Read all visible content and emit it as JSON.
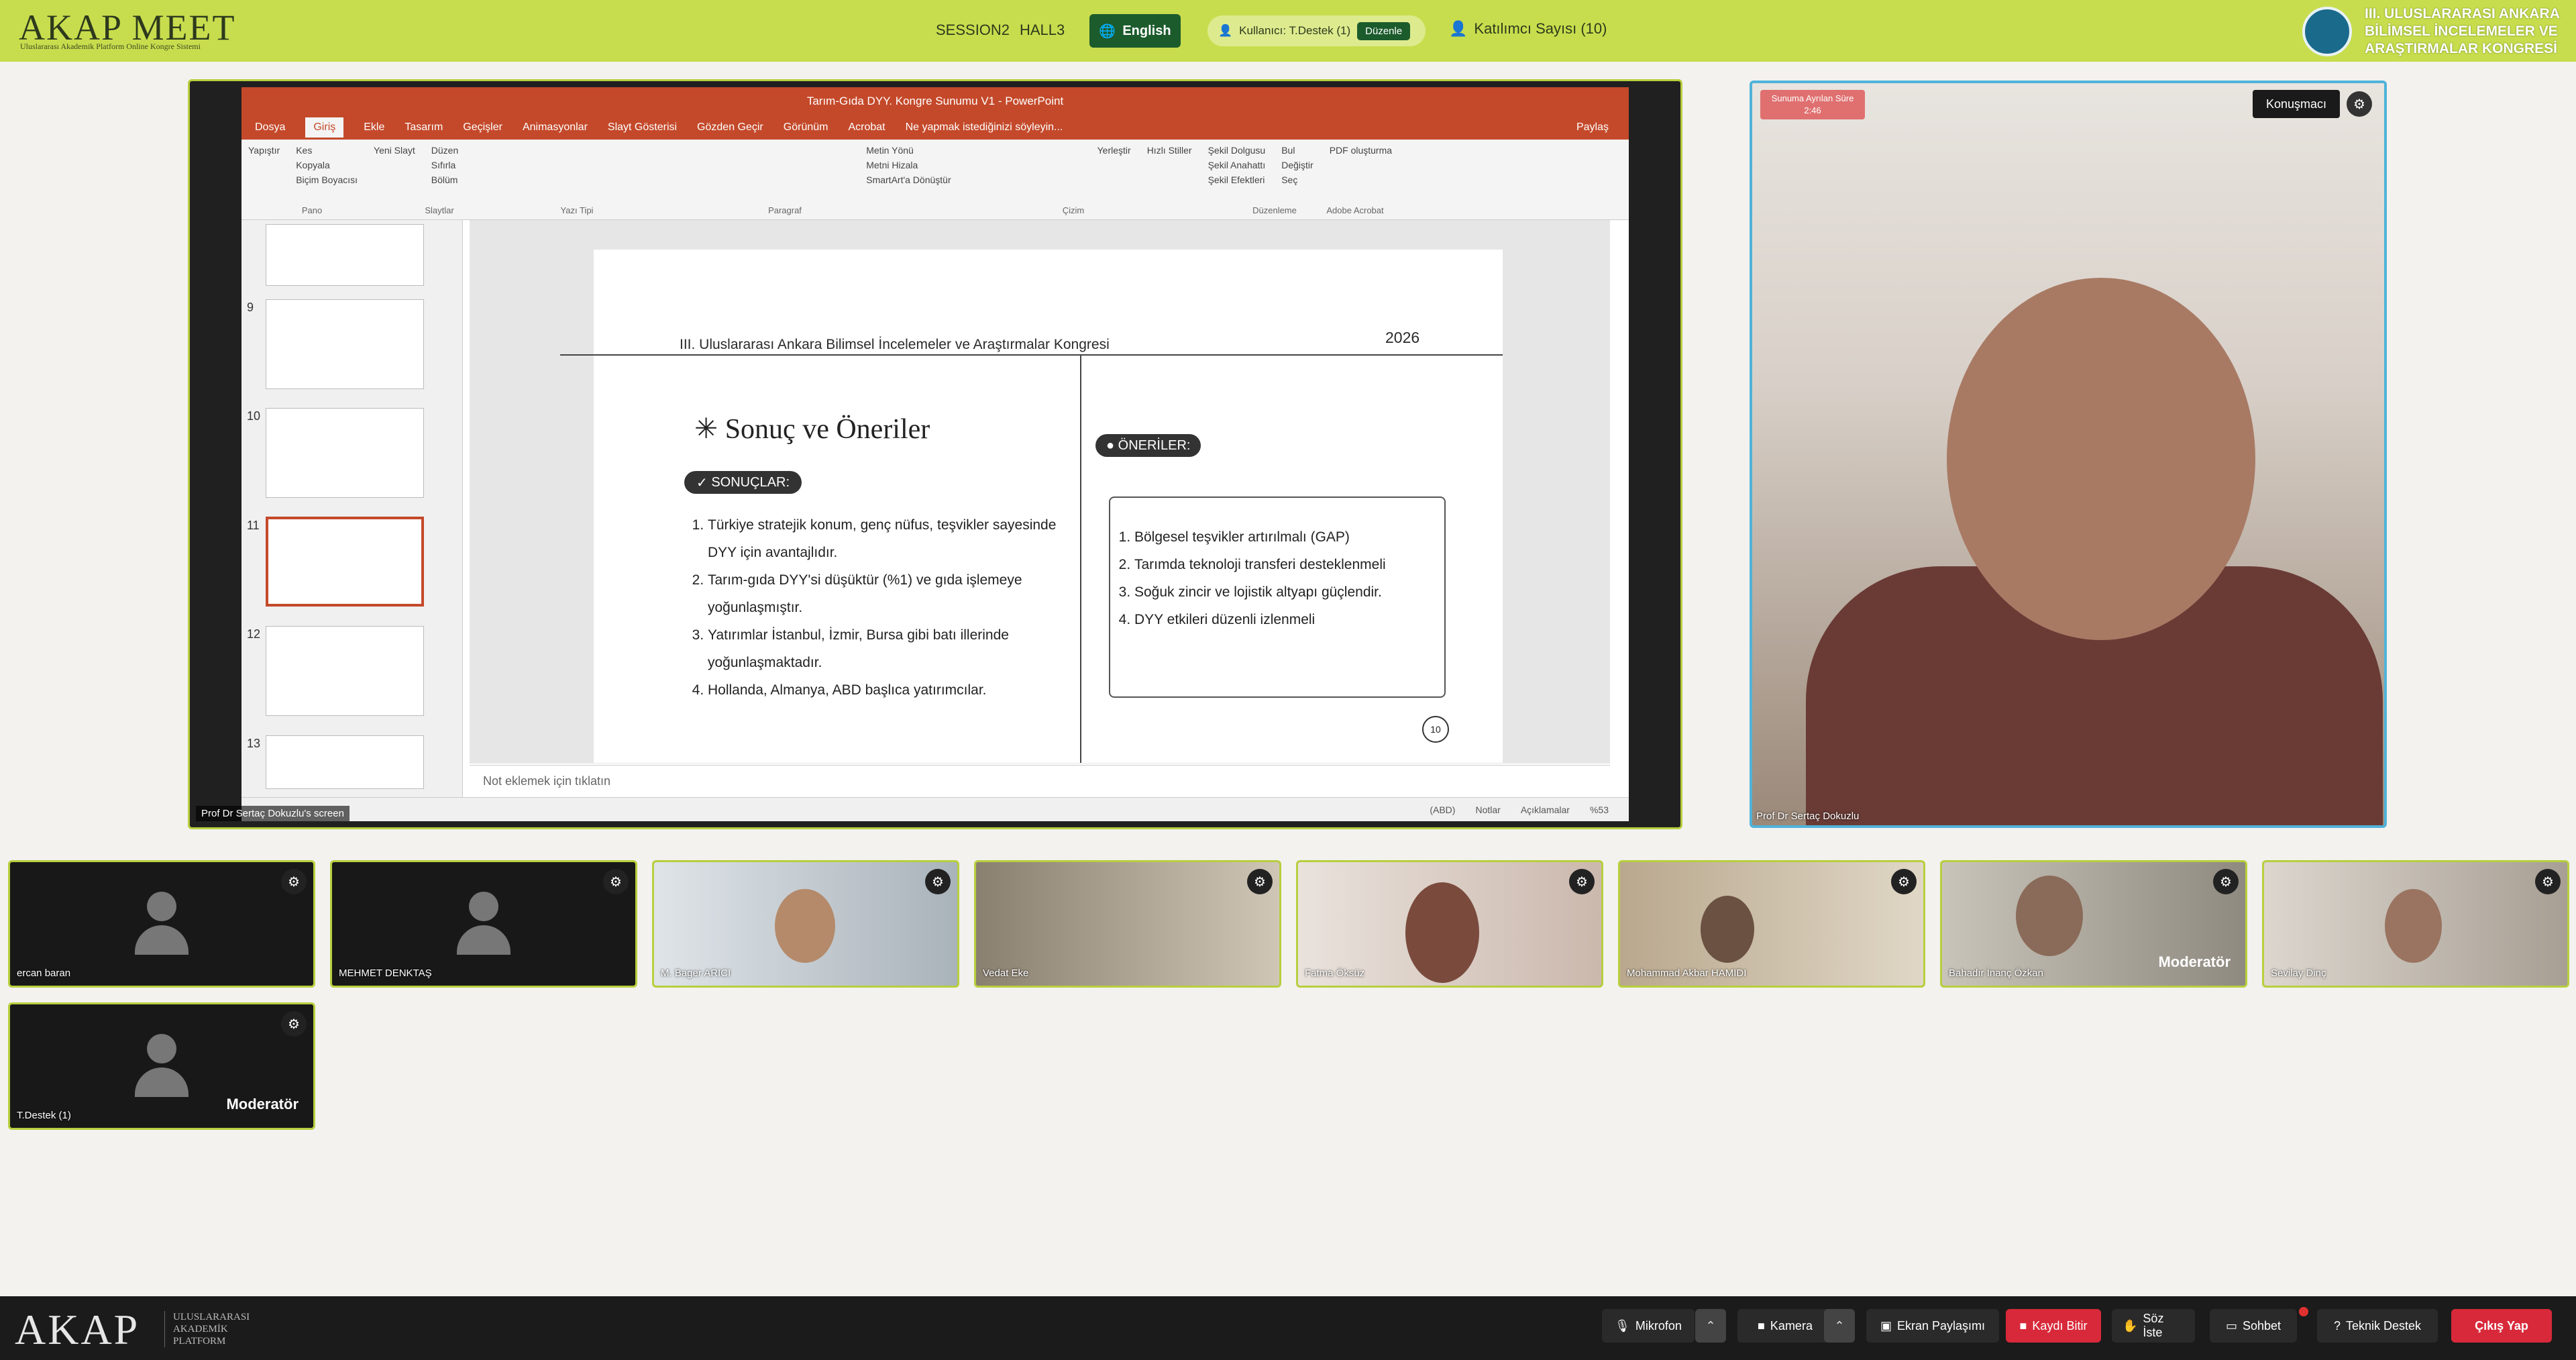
{
  "header": {
    "logo": "AKAP MEET",
    "logo_sub": "Uluslararası Akademik Platform Online Kongre Sistemi",
    "session": "SESSION2",
    "hall": "HALL3",
    "language": "English",
    "user_label": "Kullanıcı: T.Destek (1)",
    "edit_label": "Düzenle",
    "participants": "Katılımcı Sayısı (10)",
    "conference_title": [
      "III. ULUSLARARASI ANKARA",
      "BİLİMSEL İNCELEMELER VE",
      "ARAŞTIRMALAR KONGRESİ"
    ]
  },
  "powerpoint": {
    "title": "Tarım-Gıda DYY. Kongre Sunumu V1 - PowerPoint",
    "tabs": [
      "Dosya",
      "Giriş",
      "Ekle",
      "Tasarım",
      "Geçişler",
      "Animasyonlar",
      "Slayt Gösterisi",
      "Gözden Geçir",
      "Görünüm",
      "Acrobat",
      "Ne yapmak istediğinizi söyleyin..."
    ],
    "share_label": "Paylaş",
    "ribbon_groups": [
      "Pano",
      "Slaytlar",
      "Yazı Tipi",
      "Paragraf",
      "Çizim",
      "Düzenleme",
      "Adobe Acrobat"
    ],
    "ribbon_items": {
      "paste": "Yapıştır",
      "cut": "Kes",
      "copy": "Kopyala",
      "format_painter": "Biçim Boyacısı",
      "new_slide": "Yeni Slayt",
      "layout": "Düzen",
      "reset": "Sıfırla",
      "section": "Bölüm",
      "text_direction": "Metin Yönü",
      "align_text": "Metni Hizala",
      "smartart": "SmartArt'a Dönüştür",
      "arrange": "Yerleştir",
      "quick_styles": "Hızlı Stiller",
      "shape_fill": "Şekil Dolgusu",
      "shape_outline": "Şekil Anahattı",
      "shape_effects": "Şekil Efektleri",
      "find": "Bul",
      "replace": "Değiştir",
      "select": "Seç",
      "pdf": "PDF oluşturma"
    },
    "thumbnails": [
      "9",
      "10",
      "11",
      "12",
      "13"
    ],
    "notes_placeholder": "Not eklemek için tıklatın",
    "status": [
      "Notlar",
      "Açıklamalar",
      "%53"
    ],
    "region": "(ABD)"
  },
  "slide": {
    "header": "III. Uluslararası Ankara Bilimsel İncelemeler ve Araştırmalar Kongresi",
    "year": "2026",
    "title": "Sonuç ve Öneriler",
    "results_label": "SONUÇLAR:",
    "results": [
      "Türkiye stratejik konum, genç nüfus, teşvikler sayesinde DYY için avantajlıdır.",
      "Tarım-gıda DYY'si düşüktür (%1) ve gıda işlemeye yoğunlaşmıştır.",
      "Yatırımlar İstanbul, İzmir, Bursa gibi batı illerinde yoğunlaşmaktadır.",
      "Hollanda, Almanya, ABD başlıca yatırımcılar."
    ],
    "recs_label": "ÖNERİLER:",
    "recommendations": [
      "Bölgesel teşvikler artırılmalı (GAP)",
      "Tarımda teknoloji transferi desteklenmeli",
      "Soğuk zincir ve lojistik altyapı güçlendir.",
      "DYY etkileri düzenli izlenmeli"
    ],
    "page_number": "10"
  },
  "share_caption": "Prof Dr Sertaç Dokuzlu's screen",
  "main_video": {
    "timer_label": "Sunuma Ayrılan Süre",
    "timer_value": "2:46",
    "speaker_button": "Konuşmacı",
    "name": "Prof Dr Sertaç Dokuzlu"
  },
  "participants_tiles": [
    {
      "name": "ercan baran",
      "camera": false
    },
    {
      "name": "MEHMET DENKTAŞ",
      "camera": false
    },
    {
      "name": "M. Bager ARICI",
      "camera": true
    },
    {
      "name": "Vedat Eke",
      "camera": true
    },
    {
      "name": "Fatma Öksüz",
      "camera": true
    },
    {
      "name": "Mohammad Akbar HAMIDI",
      "camera": true
    },
    {
      "name": "Bahadır İnanç Özkan",
      "camera": true,
      "role": "Moderatör"
    },
    {
      "name": "Sevilay Dinç",
      "camera": true
    },
    {
      "name": "T.Destek (1)",
      "camera": false,
      "role": "Moderatör"
    }
  ],
  "bottom_bar": {
    "logo": "AKAP",
    "logo_sub": [
      "ULUSLARARASI",
      "AKADEMİK",
      "PLATFORM"
    ],
    "mic": "Mikrofon",
    "camera": "Kamera",
    "screen_share": "Ekran Paylaşımı",
    "stop_recording": "Kaydı Bitir",
    "raise_hand": "Söz İste",
    "chat": "Sohbet",
    "tech_support": "Teknik Destek",
    "exit": "Çıkış Yap"
  },
  "colors": {
    "header_bg": "#c8dd4d",
    "accent_green": "#1c5b2c",
    "ppt_red": "#c4492a",
    "exit_red": "#d8293a",
    "tile_border": "#b8cf3e",
    "speaker_border": "#4fb3d9"
  }
}
